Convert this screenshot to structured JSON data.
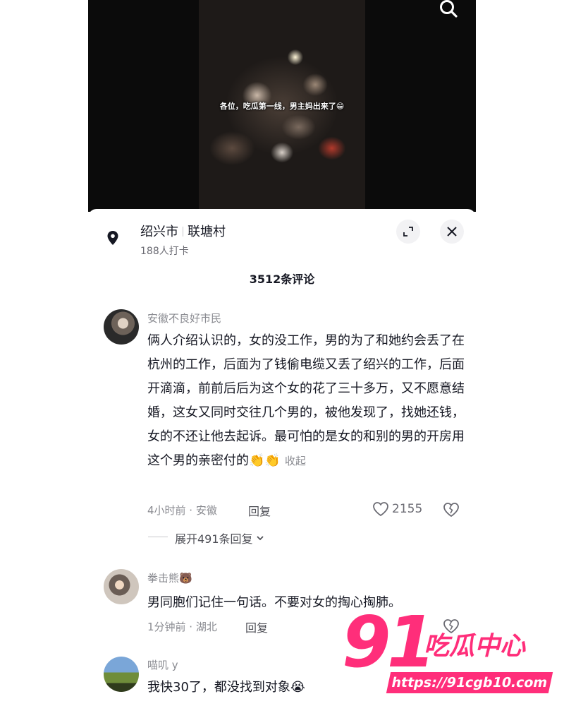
{
  "video": {
    "caption": "各位，吃瓜第一线，男主妈出来了😁"
  },
  "location": {
    "city": "绍兴市",
    "village": "联塘村",
    "checkins": "188人打卡"
  },
  "comments_count": "3512条评论",
  "comments": [
    {
      "user": "安徽不良好市民",
      "text": "俩人介绍认识的，女的没工作，男的为了和她约会丢了在杭州的工作，后面为了钱偷电缆又丢了绍兴的工作，后面开滴滴，前前后后为这个女的花了三十多万，又不愿意结婚，这女又同时交往几个男的，被他发现了，找她还钱，女的不还让他去起诉。最可怕的是女的和别的男的开房用这个男的亲密付的👏👏",
      "collapse": "收起",
      "meta": "4小时前 · 安徽",
      "reply": "回复",
      "likes": "2155",
      "expand_replies": "展开491条回复"
    },
    {
      "user": "拳击熊🐻",
      "text": "男同胞们记住一句话。不要对女的掏心掏肺。",
      "meta": "1分钟前 · 湖北",
      "reply": "回复"
    },
    {
      "user": "喵叽 y",
      "text": "我快30了，都没找到对象😭"
    }
  ],
  "watermark": {
    "number": "91",
    "brand": "吃瓜中心",
    "url": "https://91cgb10.com"
  },
  "icons": [
    "search-icon",
    "location-pin-icon",
    "expand-icon",
    "close-icon",
    "heart-icon",
    "broken-heart-icon",
    "chevron-down-icon"
  ]
}
